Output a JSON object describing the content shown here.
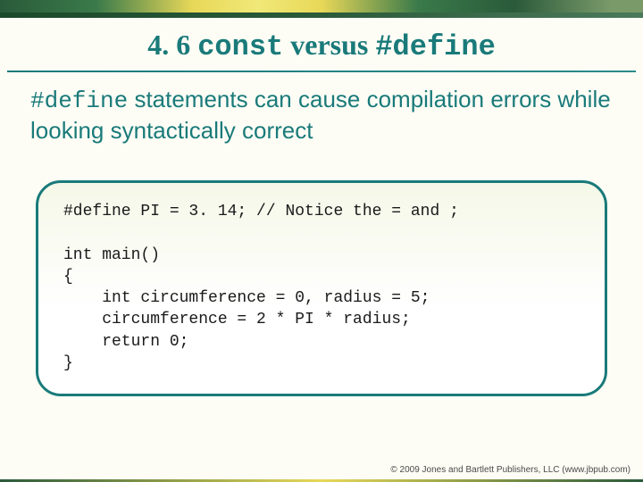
{
  "title": {
    "prefix": "4. 6 ",
    "code1": "const",
    "mid": " versus ",
    "code2": "#define"
  },
  "subtitle": {
    "code": "#define",
    "rest": " statements can cause compilation errors while looking syntactically correct"
  },
  "code": {
    "line1": "#define PI = 3. 14; // Notice the = and ;",
    "blank": "",
    "line2": "int main()",
    "line3": "{",
    "line4": "    int circumference = 0, radius = 5;",
    "line5": "    circumference = 2 * PI * radius;",
    "line6": "    return 0;",
    "line7": "}"
  },
  "footer": "© 2009 Jones and Bartlett Publishers, LLC (www.jbpub.com)"
}
